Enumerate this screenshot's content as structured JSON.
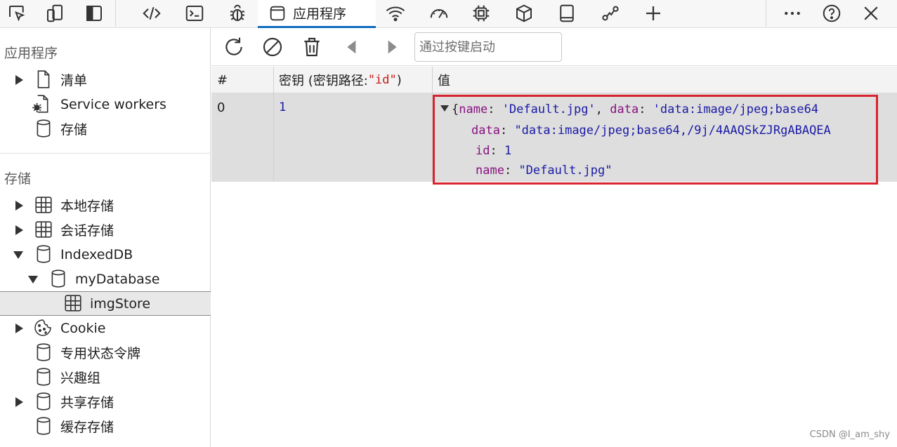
{
  "toolbar": {
    "icons": [
      "inspect-icon",
      "device-emulation-icon",
      "dock-icon",
      "elements-icon",
      "console-icon",
      "debugger-icon",
      "application-icon",
      "network-icon",
      "performance-icon",
      "memory-icon",
      "modules-icon",
      "sources-icon",
      "connections-icon",
      "add-tool-icon",
      "more-icon",
      "help-icon",
      "close-icon"
    ],
    "active_tab_label": "应用程序"
  },
  "sidebar": {
    "section_app": "应用程序",
    "app_items": [
      {
        "label": "清单",
        "icon": "document-icon",
        "expand": "collapsed"
      },
      {
        "label": "Service workers",
        "icon": "service-worker-icon",
        "expand": "none"
      },
      {
        "label": "存储",
        "icon": "database-icon",
        "expand": "none"
      }
    ],
    "section_storage": "存储",
    "storage_items": [
      {
        "label": "本地存储",
        "icon": "grid-icon",
        "expand": "collapsed"
      },
      {
        "label": "会话存储",
        "icon": "grid-icon",
        "expand": "collapsed"
      },
      {
        "label": "IndexedDB",
        "icon": "database-icon",
        "expand": "expanded"
      },
      {
        "label": "myDatabase",
        "icon": "database-icon",
        "expand": "expanded"
      },
      {
        "label": "imgStore",
        "icon": "grid-icon",
        "expand": "none",
        "selected": true
      },
      {
        "label": "Cookie",
        "icon": "cookie-icon",
        "expand": "collapsed"
      },
      {
        "label": "专用状态令牌",
        "icon": "database-icon",
        "expand": "none"
      },
      {
        "label": "兴趣组",
        "icon": "database-icon",
        "expand": "none"
      },
      {
        "label": "共享存储",
        "icon": "database-icon",
        "expand": "collapsed"
      },
      {
        "label": "缓存存储",
        "icon": "database-icon",
        "expand": "none"
      }
    ]
  },
  "main": {
    "filter_placeholder": "通过按键启动",
    "columns": {
      "index": "#",
      "key_prefix": "密钥 (密钥路径: ",
      "key_path": "\"id\"",
      "key_suffix": ")",
      "value": "值"
    },
    "row": {
      "index": "0",
      "key": "1",
      "summary_brace": "{",
      "summary_k1": "name",
      "summary_v1": "'Default.jpg'",
      "summary_k2": "data",
      "summary_v2": "'data:image/jpeg;base64",
      "prop_data_key": "data",
      "prop_data_val": "\"data:image/jpeg;base64,/9j/4AAQSkZJRgABAQEA",
      "prop_id_key": "id",
      "prop_id_val": "1",
      "prop_name_key": "name",
      "prop_name_val": "\"Default.jpg\""
    }
  },
  "watermark": "CSDN @I_am_shy",
  "colors": {
    "accent": "#0f6cbd",
    "highlight_border": "#d9232f",
    "json_key": "#881280",
    "json_string": "#1a1aa6",
    "row_bg": "#dedede"
  }
}
